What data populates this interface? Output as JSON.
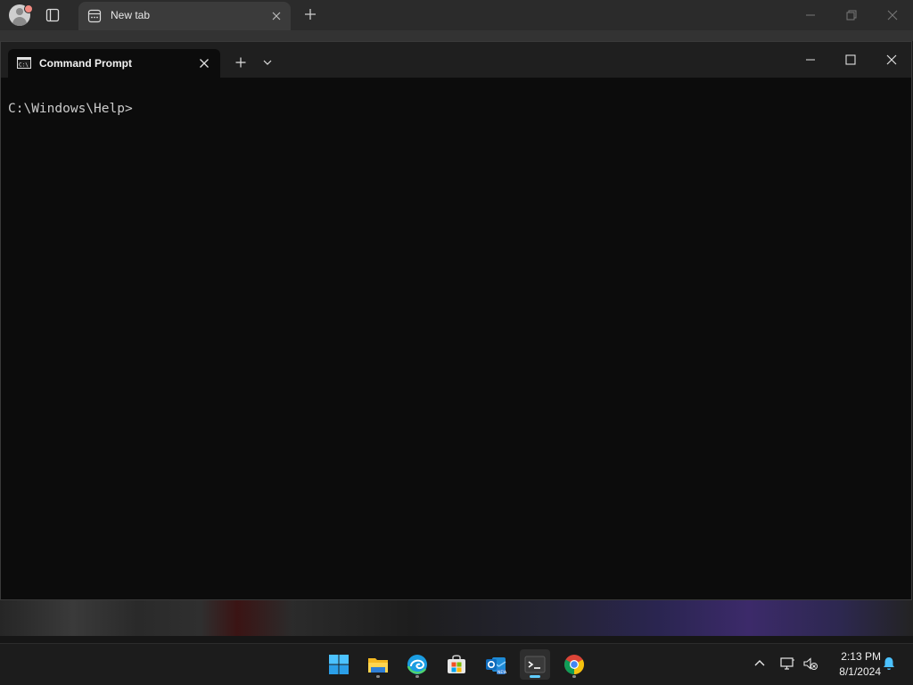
{
  "browser": {
    "tab_label": "New tab"
  },
  "terminal": {
    "tab_label": "Command Prompt",
    "prompt": "C:\\Windows\\Help>"
  },
  "taskbar": {
    "apps": [
      "windows-start-icon",
      "file-explorer-icon",
      "edge-icon",
      "microsoft-store-icon",
      "outlook-new-icon",
      "terminal-icon",
      "chrome-icon"
    ],
    "active_app": "terminal-icon",
    "time": "2:13 PM",
    "date": "8/1/2024"
  },
  "colors": {
    "terminal_bg": "#0c0c0c",
    "accent": "#60cdff"
  }
}
